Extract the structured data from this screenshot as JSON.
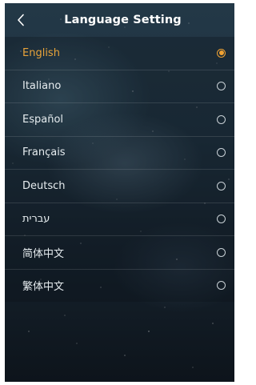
{
  "header": {
    "title": "Language Setting",
    "back_icon": "chevron-left-icon"
  },
  "languages": [
    {
      "label": "English",
      "selected": true
    },
    {
      "label": "Italiano",
      "selected": false
    },
    {
      "label": "Español",
      "selected": false
    },
    {
      "label": "Français",
      "selected": false
    },
    {
      "label": "Deutsch",
      "selected": false
    },
    {
      "label": "עברית",
      "selected": false
    },
    {
      "label": "简体中文",
      "selected": false
    },
    {
      "label": "繁体中文",
      "selected": false
    }
  ],
  "colors": {
    "accent": "#f0a232",
    "text": "#e6ecef",
    "background": "#1f3240"
  }
}
